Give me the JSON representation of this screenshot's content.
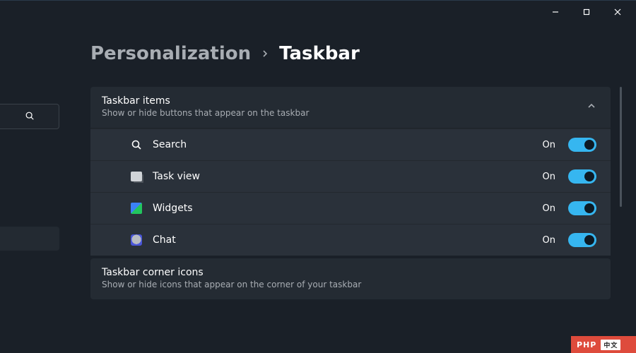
{
  "breadcrumb": {
    "parent": "Personalization",
    "current": "Taskbar"
  },
  "sections": {
    "items": {
      "title": "Taskbar items",
      "subtitle": "Show or hide buttons that appear on the taskbar",
      "expanded": true,
      "rows": [
        {
          "icon": "search-icon",
          "label": "Search",
          "state": "On",
          "on": true
        },
        {
          "icon": "taskview-icon",
          "label": "Task view",
          "state": "On",
          "on": true
        },
        {
          "icon": "widgets-icon",
          "label": "Widgets",
          "state": "On",
          "on": true
        },
        {
          "icon": "chat-icon",
          "label": "Chat",
          "state": "On",
          "on": true
        }
      ]
    },
    "corner": {
      "title": "Taskbar corner icons",
      "subtitle": "Show or hide icons that appear on the corner of your taskbar",
      "expanded": false
    }
  },
  "watermark": {
    "brand": "PHP"
  }
}
